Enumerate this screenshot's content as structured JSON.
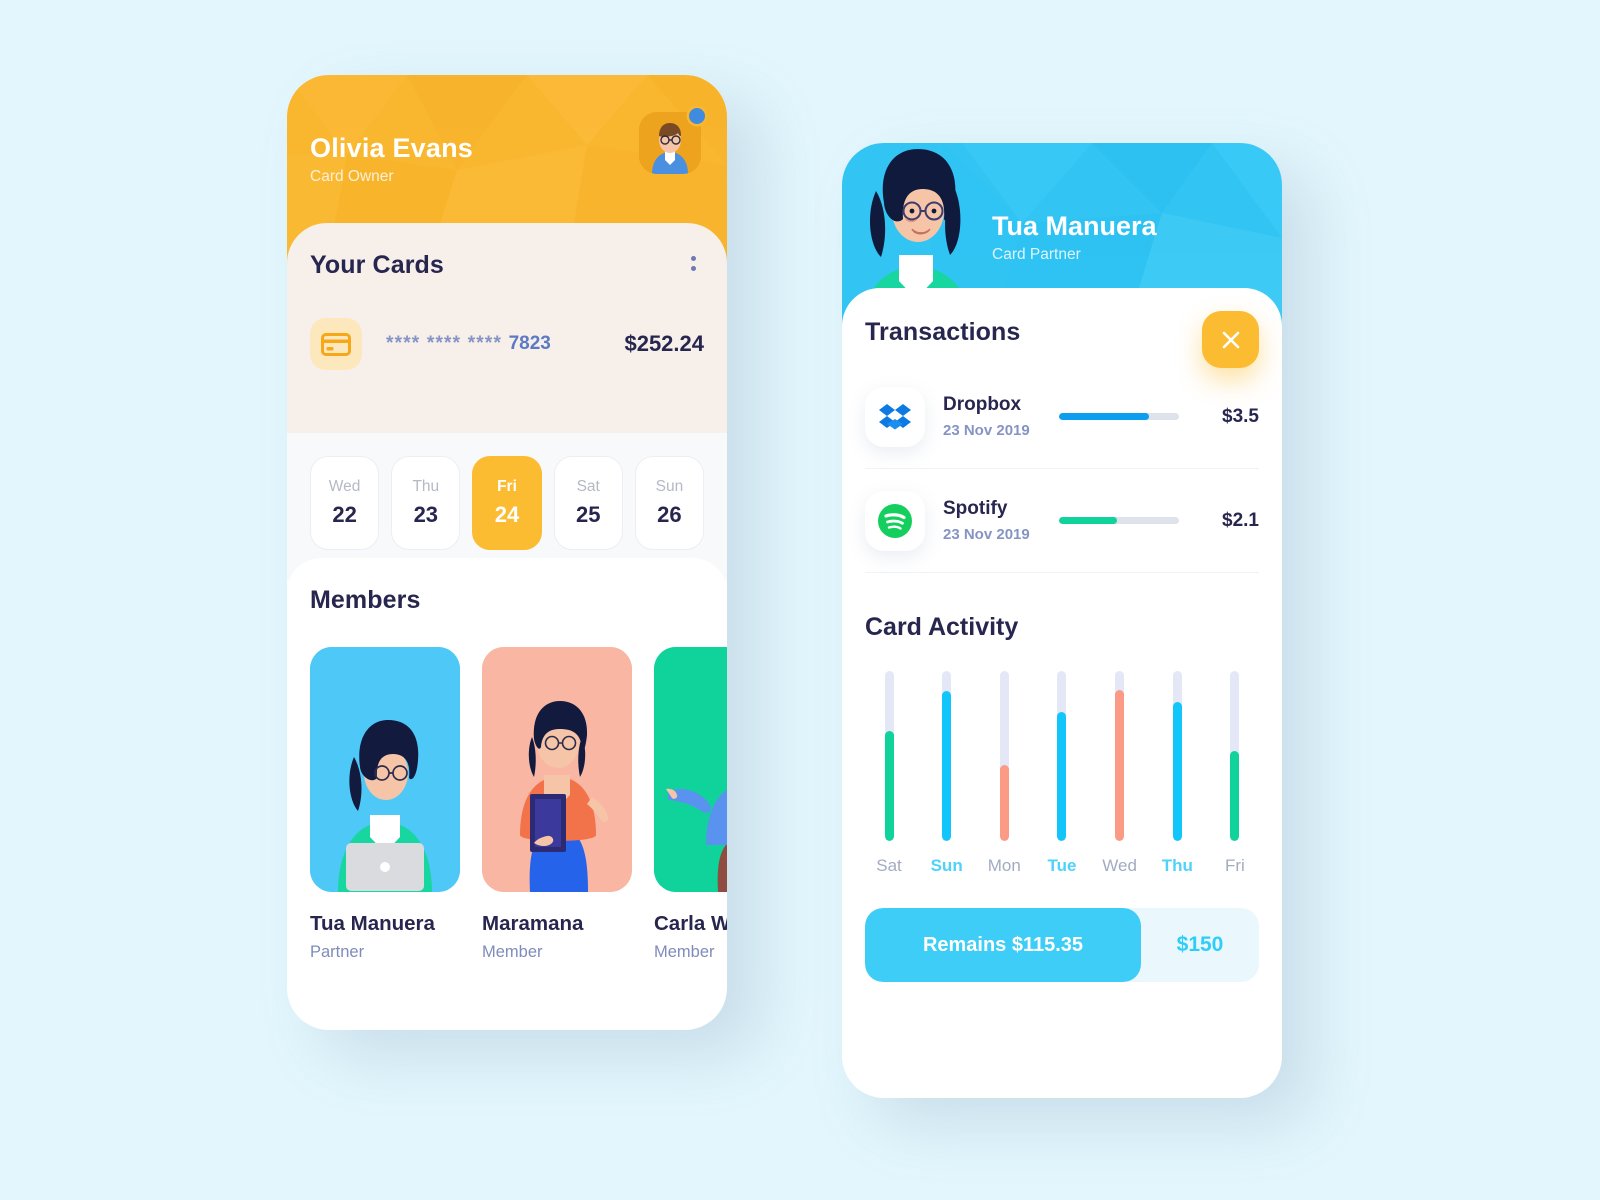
{
  "theme": {
    "background": "#e3f6fd",
    "yellow": "#f9b730",
    "cyan": "#32c5f4",
    "navy": "#27264e",
    "green": "#10d29b",
    "salmon": "#fb9a85",
    "blue_bar": "#0d9ef0",
    "track": "#e4e8f6"
  },
  "left_phone": {
    "header": {
      "name": "Olivia Evans",
      "role": "Card Owner",
      "avatar_icon": "male-avatar",
      "status_dot": "online-badge"
    },
    "cards_section": {
      "title": "Your Cards",
      "menu_icon": "kebab-menu-icon",
      "card": {
        "icon": "credit-card-icon",
        "masked": "****  ****  ****",
        "last4": "7823",
        "amount": "$252.24"
      }
    },
    "dates": [
      {
        "day": "Wed",
        "num": "22",
        "active": false
      },
      {
        "day": "Thu",
        "num": "23",
        "active": false
      },
      {
        "day": "Fri",
        "num": "24",
        "active": true
      },
      {
        "day": "Sat",
        "num": "25",
        "active": false
      },
      {
        "day": "Sun",
        "num": "26",
        "active": false
      }
    ],
    "members_section": {
      "title": "Members",
      "members": [
        {
          "name": "Tua Manuera",
          "role": "Partner",
          "bg": "#4ec8f7",
          "avatar": "woman-with-laptop"
        },
        {
          "name": "Maramana",
          "role": "Member",
          "bg": "#f9b7a3",
          "avatar": "woman-with-book"
        },
        {
          "name": "Carla W",
          "role": "Member",
          "bg": "#10d29b",
          "avatar": "man-with-glasses"
        }
      ]
    }
  },
  "right_phone": {
    "header": {
      "name": "Tua Manuera",
      "role": "Card Partner",
      "avatar_icon": "woman-avatar",
      "close_icon": "close-x-icon"
    },
    "transactions_section": {
      "title": "Transactions",
      "items": [
        {
          "name": "Dropbox",
          "date": "23 Nov 2019",
          "amount": "$3.5",
          "progress": 75,
          "color": "#0d9ef0",
          "icon": "dropbox-icon"
        },
        {
          "name": "Spotify",
          "date": "23 Nov 2019",
          "amount": "$2.1",
          "progress": 48,
          "color": "#10d29b",
          "icon": "spotify-icon"
        }
      ]
    },
    "activity_section": {
      "title": "Card Activity"
    },
    "footer": {
      "remains_label": "Remains $115.35",
      "limit_label": "$150"
    }
  },
  "chart_data": {
    "type": "bar",
    "title": "Card Activity",
    "xlabel": "",
    "ylabel": "",
    "categories": [
      "Sat",
      "Sun",
      "Mon",
      "Tue",
      "Wed",
      "Thu",
      "Fri"
    ],
    "values": [
      65,
      88,
      45,
      76,
      89,
      82,
      53
    ],
    "ylim": [
      0,
      100
    ],
    "grid": false,
    "legend": null,
    "bar_colors": [
      "#10d29b",
      "#12c6fb",
      "#fb9a85",
      "#12c6fb",
      "#fb9a85",
      "#12c6fb",
      "#10d29b"
    ],
    "label_highlighted": [
      false,
      true,
      false,
      true,
      false,
      true,
      false
    ],
    "track_color": "#e4e8f6",
    "note": "Each bar is a vertical track with a colored fill rising from the bottom; values are percent of track height."
  }
}
